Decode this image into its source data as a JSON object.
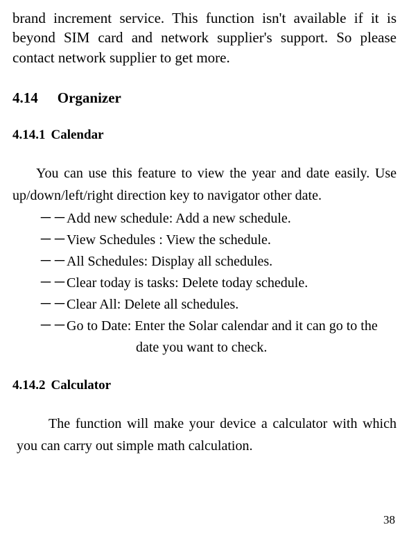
{
  "intro_paragraph": "brand increment service. This function isn't available if it is beyond SIM card and network supplier's support. So please contact network supplier to get more.",
  "section": {
    "number": "4.14",
    "title": "Organizer"
  },
  "subsection_calendar": {
    "number": "4.14.1",
    "title": "Calendar",
    "intro": "You can use this feature to view the year and date easily. Use up/down/left/right direction key to navigator other date.",
    "items": [
      "－－Add new schedule: Add a new schedule.",
      "－－View Schedules : View the schedule.",
      "－－All Schedules: Display all schedules.",
      "－－Clear today is tasks: Delete today schedule.",
      "－－Clear All: Delete all schedules.",
      "－－Go to Date: Enter the Solar calendar and it can go to the"
    ],
    "item_continuation": "date you want to check."
  },
  "subsection_calculator": {
    "number": "4.14.2",
    "title": "Calculator",
    "body": "The function will make your device a calculator with which you can carry out simple math calculation."
  },
  "page_number": "38"
}
